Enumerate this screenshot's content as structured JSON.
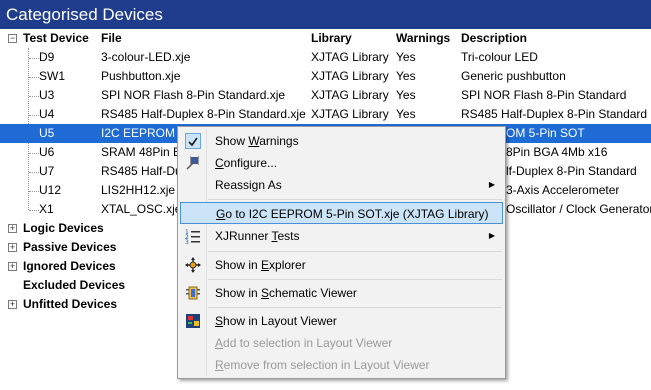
{
  "window": {
    "title": "Categorised Devices"
  },
  "columns": {
    "device": "Test Device",
    "file": "File",
    "library": "Library",
    "warnings": "Warnings",
    "description": "Description"
  },
  "devices": [
    {
      "name": "D9",
      "file": "3-colour-LED.xje",
      "library": "XJTAG Library",
      "warnings": "Yes",
      "description": "Tri-colour LED"
    },
    {
      "name": "SW1",
      "file": "Pushbutton.xje",
      "library": "XJTAG Library",
      "warnings": "Yes",
      "description": "Generic pushbutton"
    },
    {
      "name": "U3",
      "file": "SPI NOR Flash 8-Pin Standard.xje",
      "library": "XJTAG Library",
      "warnings": "Yes",
      "description": "SPI NOR Flash 8-Pin Standard"
    },
    {
      "name": "U4",
      "file": "RS485 Half-Duplex 8-Pin Standard.xje",
      "library": "XJTAG Library",
      "warnings": "Yes",
      "description": "RS485 Half-Duplex 8-Pin Standard"
    },
    {
      "name": "U5",
      "file": "I2C EEPROM 5-",
      "library": "",
      "warnings": "",
      "description": "OM 5-Pin SOT"
    },
    {
      "name": "U6",
      "file": "SRAM 48Pin BG",
      "library": "",
      "warnings": "",
      "description": "8Pin BGA 4Mb x16"
    },
    {
      "name": "U7",
      "file": "RS485 Half-Du",
      "library": "",
      "warnings": "",
      "description": "lf-Duplex 8-Pin Standard"
    },
    {
      "name": "U12",
      "file": "LIS2HH12.xje",
      "library": "",
      "warnings": "",
      "description": "3-Axis Accelerometer"
    },
    {
      "name": "X1",
      "file": "XTAL_OSC.xje",
      "library": "",
      "warnings": "",
      "description": "Oscillator / Clock Generator"
    }
  ],
  "groups": [
    "Logic Devices",
    "Passive Devices",
    "Ignored Devices",
    "Excluded Devices",
    "Unfitted Devices"
  ],
  "context_menu": {
    "show_warnings": {
      "pre": "Show ",
      "key": "W",
      "post": "arnings"
    },
    "configure": {
      "pre": "",
      "key": "C",
      "post": "onfigure..."
    },
    "reassign_as": "Reassign As",
    "goto": {
      "pre": "",
      "key": "G",
      "post": "o to I2C EEPROM 5-Pin SOT.xje (XJTAG Library)"
    },
    "xjrunner": {
      "pre": "XJRunner ",
      "key": "T",
      "post": "ests"
    },
    "explorer": {
      "pre": "Show in ",
      "key": "E",
      "post": "xplorer"
    },
    "schematic": {
      "pre": "Show in ",
      "key": "S",
      "post": "chematic Viewer"
    },
    "layout": {
      "pre": "",
      "key": "S",
      "post": "how in Layout Viewer"
    },
    "add_sel": {
      "pre": "",
      "key": "A",
      "post": "dd to selection in Layout Viewer"
    },
    "remove_sel": {
      "pre": "",
      "key": "R",
      "post": "emove from selection in Layout Viewer"
    }
  }
}
